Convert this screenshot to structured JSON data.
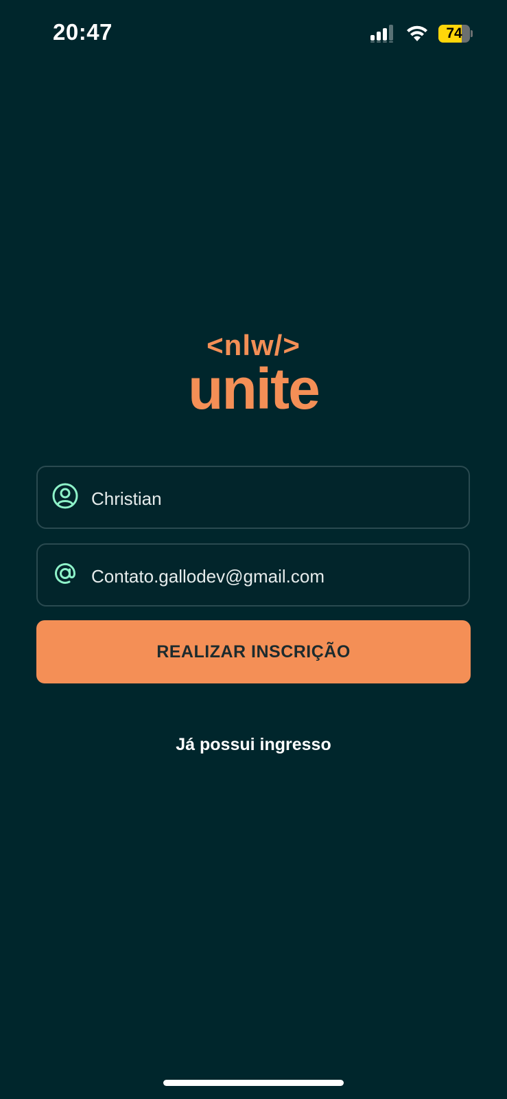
{
  "status_bar": {
    "time": "20:47",
    "battery_level": "74",
    "battery_fraction": 0.74,
    "icons": [
      "cellular-signal-icon",
      "wifi-icon",
      "battery-icon"
    ]
  },
  "logo": {
    "top": "<nlw/>",
    "bottom": "unite"
  },
  "form": {
    "name_field": {
      "icon": "user-circle-icon",
      "value": "Christian"
    },
    "email_field": {
      "icon": "at-sign-icon",
      "value": "Contato.gallodev@gmail.com"
    },
    "submit_label": "REALIZAR INSCRIÇÃO",
    "login_link": "Já possui ingresso"
  },
  "colors": {
    "background": "#00262c",
    "accent": "#f48f56",
    "icon_green": "#8ef2c9",
    "field_border": "#2a4a50",
    "battery_yellow": "#ffd60a"
  }
}
